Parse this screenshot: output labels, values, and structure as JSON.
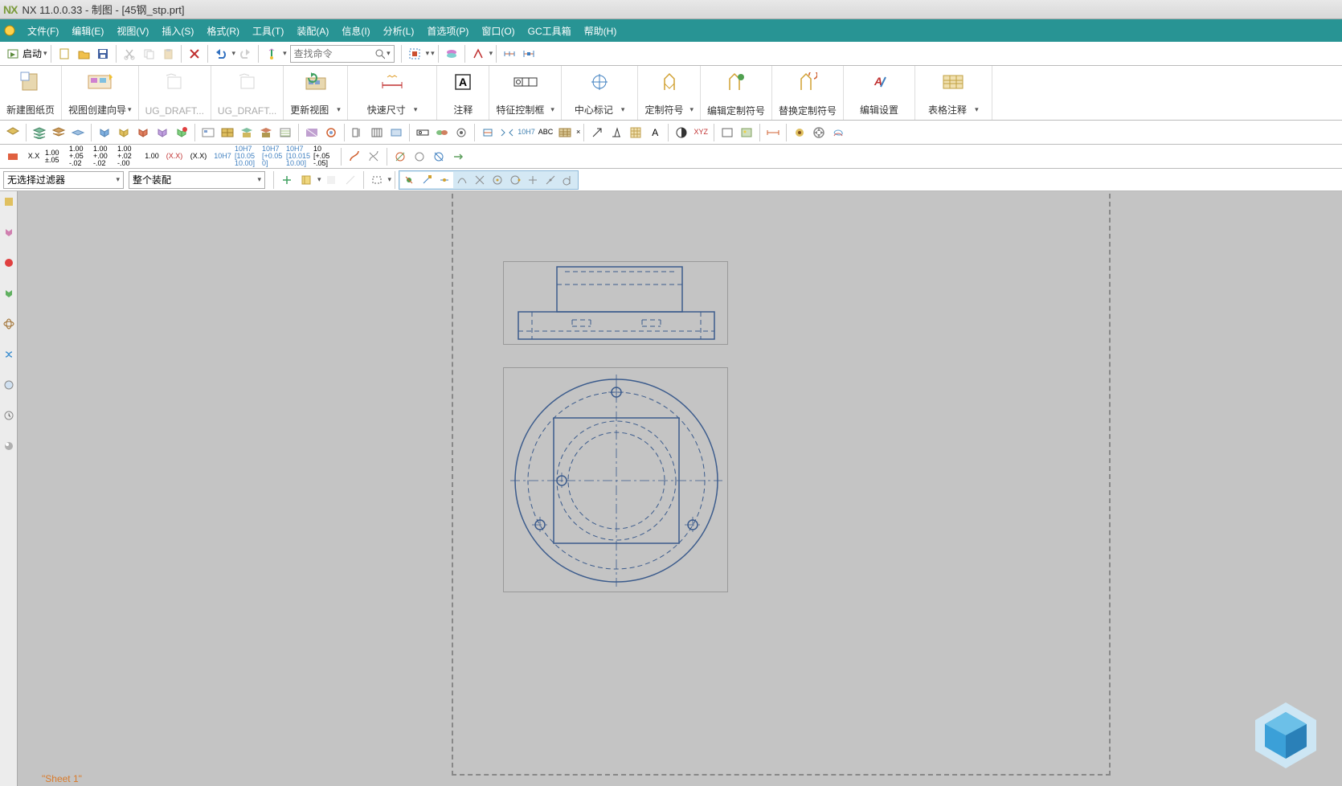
{
  "title": {
    "nx": "NX",
    "text": "NX 11.0.0.33 - 制图 - [45钢_stp.prt]"
  },
  "menu": {
    "items": [
      "文件(F)",
      "编辑(E)",
      "视图(V)",
      "插入(S)",
      "格式(R)",
      "工具(T)",
      "装配(A)",
      "信息(I)",
      "分析(L)",
      "首选项(P)",
      "窗口(O)",
      "GC工具箱",
      "帮助(H)"
    ]
  },
  "toolbar1": {
    "launch": "启动",
    "search_ph": "查找命令"
  },
  "ribbon": {
    "items": [
      {
        "label": "新建图纸页",
        "disabled": false
      },
      {
        "label": "视图创建向导",
        "disabled": false
      },
      {
        "label": "UG_DRAFT...",
        "disabled": true
      },
      {
        "label": "UG_DRAFT...",
        "disabled": true
      },
      {
        "label": "更新视图",
        "disabled": false
      },
      {
        "label": "快速尺寸",
        "disabled": false
      },
      {
        "label": "注释",
        "disabled": false
      },
      {
        "label": "特征控制框",
        "disabled": false
      },
      {
        "label": "中心标记",
        "disabled": false
      },
      {
        "label": "定制符号",
        "disabled": false
      },
      {
        "label": "编辑定制符号",
        "disabled": false
      },
      {
        "label": "替换定制符号",
        "disabled": false
      },
      {
        "label": "编辑设置",
        "disabled": false
      },
      {
        "label": "表格注释",
        "disabled": false
      }
    ]
  },
  "precision": {
    "items": [
      "X.X",
      "1.00 ±.05",
      "1.00 +.05 -.02",
      "1.00 +.00 -.02",
      "1.00 +.02 -.00",
      "1.00",
      "(X.X)",
      "(X.X)",
      "10H7",
      "10H7 [10.05 10.00]",
      "10H7 [+0.05 0]",
      "10H7 [10.015 10.00]",
      "10 [+.05 -.05]"
    ]
  },
  "filter": {
    "none": "无选择过滤器",
    "assembly": "整个装配"
  },
  "sheet_label": "\"Sheet 1\""
}
